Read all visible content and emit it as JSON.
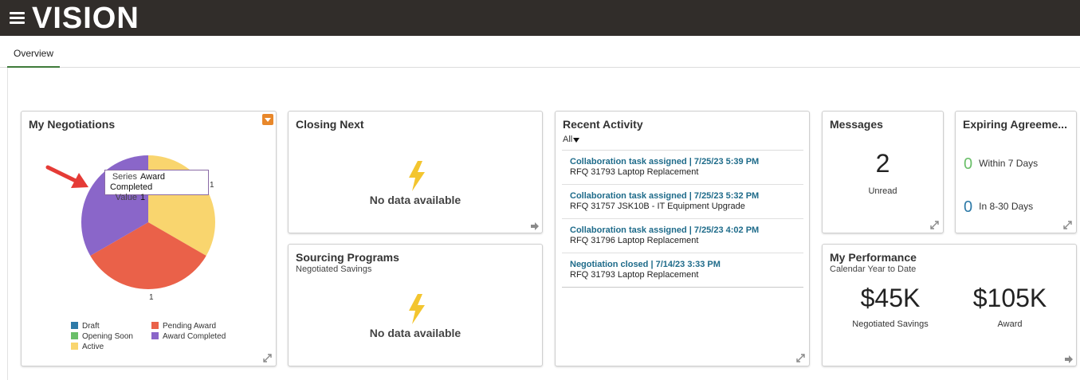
{
  "header": {
    "brand": "VISION",
    "menu_icon": "hamburger-icon"
  },
  "tabs": [
    {
      "label": "Overview",
      "active": true
    }
  ],
  "colors": {
    "draft": "#2e7aa8",
    "opening_soon": "#6abf69",
    "active": "#f9d56e",
    "pending_award": "#ea6149",
    "award_completed": "#8a66c9",
    "accent": "#e8872a"
  },
  "negotiations": {
    "title": "My Negotiations",
    "labels": {
      "right": "1",
      "bottom": "1"
    },
    "tooltip": {
      "series_key": "Series",
      "series_value": "Award Completed",
      "value_key": "Value",
      "value_value": "1"
    },
    "legend": [
      "Draft",
      "Opening Soon",
      "Active",
      "Pending Award",
      "Award Completed"
    ]
  },
  "chart_data": {
    "type": "pie",
    "categories": [
      "Active",
      "Pending Award",
      "Award Completed"
    ],
    "values": [
      1,
      1,
      1
    ],
    "legend": [
      "Draft",
      "Opening Soon",
      "Active",
      "Pending Award",
      "Award Completed"
    ]
  },
  "closing_next": {
    "title": "Closing Next",
    "empty": "No data available"
  },
  "sourcing": {
    "title": "Sourcing Programs",
    "subtitle": "Negotiated Savings",
    "empty": "No data available"
  },
  "recent": {
    "title": "Recent Activity",
    "filter": "All",
    "items": [
      {
        "link": "Collaboration task assigned | 7/25/23 5:39 PM",
        "desc": "RFQ 31793 Laptop Replacement"
      },
      {
        "link": "Collaboration task assigned | 7/25/23 5:32 PM",
        "desc": "RFQ 31757 JSK10B - IT Equipment Upgrade"
      },
      {
        "link": "Collaboration task assigned | 7/25/23 4:02 PM",
        "desc": "RFQ 31796 Laptop Replacement"
      },
      {
        "link": "Negotiation closed | 7/14/23 3:33 PM",
        "desc": "RFQ 31793 Laptop Replacement"
      }
    ]
  },
  "messages": {
    "title": "Messages",
    "count": "2",
    "label": "Unread"
  },
  "expiring": {
    "title": "Expiring Agreeme...",
    "rows": [
      {
        "count": "0",
        "label": "Within 7 Days"
      },
      {
        "count": "0",
        "label": "In 8-30 Days"
      }
    ]
  },
  "performance": {
    "title": "My Performance",
    "subtitle": "Calendar Year to Date",
    "metrics": [
      {
        "value": "$45K",
        "label": "Negotiated Savings"
      },
      {
        "value": "$105K",
        "label": "Award"
      }
    ]
  }
}
